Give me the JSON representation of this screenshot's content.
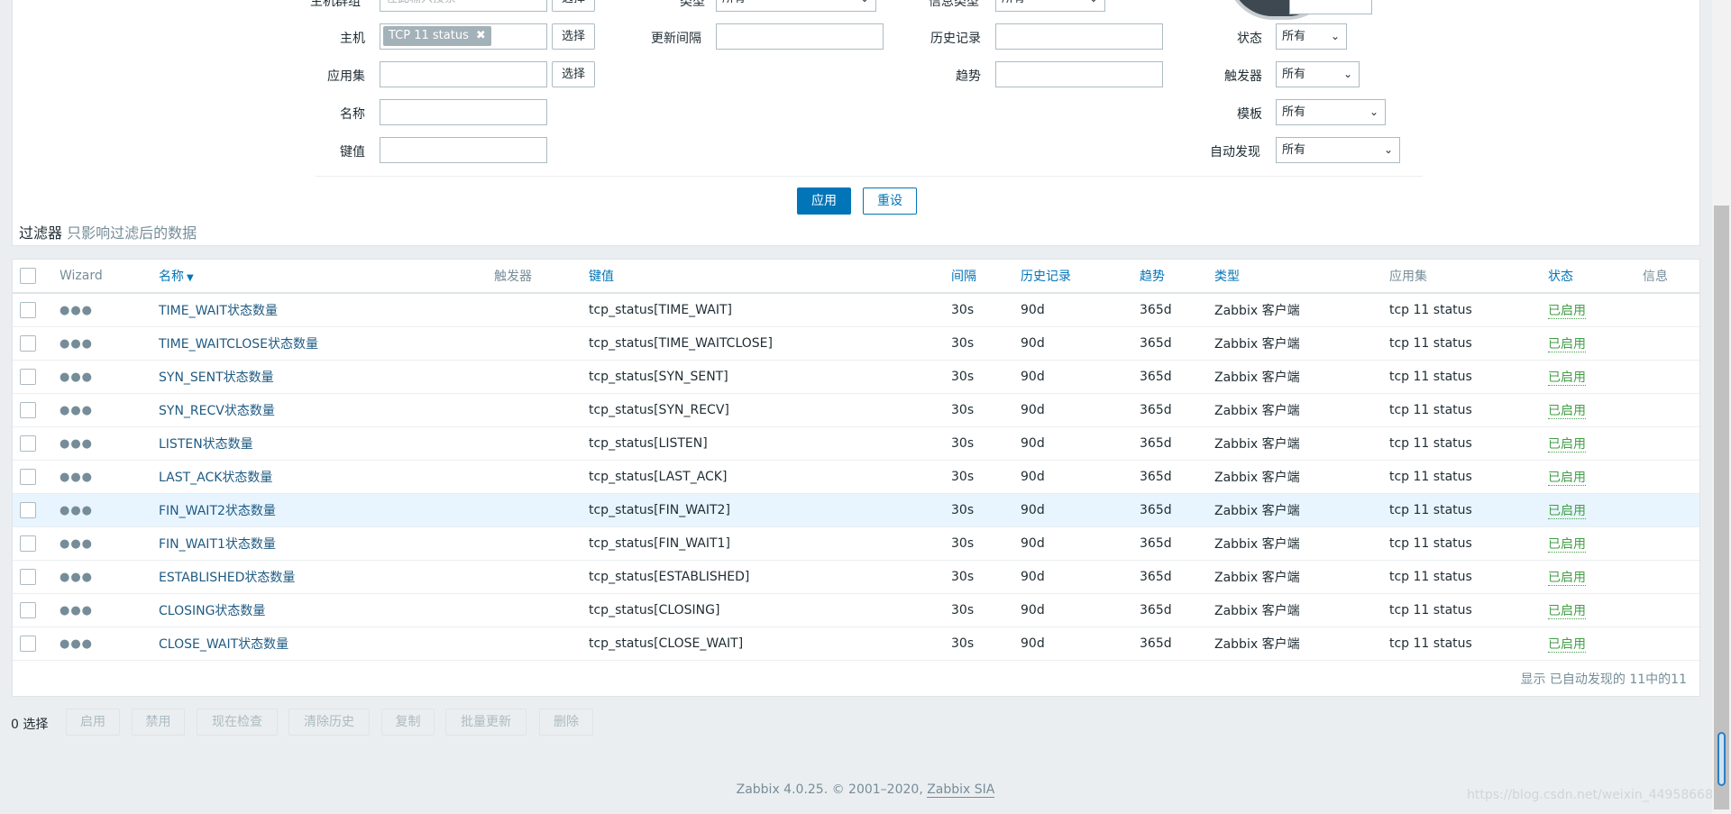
{
  "filter": {
    "top_partial": {
      "host_group_label": "主机群组",
      "host_group_placeholder": "在此输入搜索",
      "host_group_button": "选择",
      "type_label": "类型",
      "type_value": "所有",
      "info_type_label": "信息类型",
      "info_type_value": "所有"
    },
    "host_label": "主机",
    "host_tag": "TCP 11 status",
    "host_button": "选择",
    "application_label": "应用集",
    "application_button": "选择",
    "name_label": "名称",
    "key_label": "键值",
    "update_interval_label": "更新间隔",
    "history_label": "历史记录",
    "trends_label": "趋势",
    "state_label": "状态",
    "state_value": "所有",
    "triggers_label": "触发器",
    "triggers_value": "所有",
    "template_label": "模板",
    "template_value": "所有",
    "discovery_label": "自动发现",
    "discovery_value": "所有",
    "apply_button": "应用",
    "reset_button": "重设",
    "caption": "过滤器",
    "caption_sub": "只影响过滤后的数据"
  },
  "table": {
    "headers": {
      "wizard": "Wizard",
      "name": "名称",
      "triggers": "触发器",
      "key": "键值",
      "interval": "间隔",
      "history": "历史记录",
      "trends": "趋势",
      "type": "类型",
      "applications": "应用集",
      "status": "状态",
      "info": "信息"
    },
    "rows": [
      {
        "name": "TIME_WAIT状态数量",
        "key": "tcp_status[TIME_WAIT]",
        "interval": "30s",
        "history": "90d",
        "trends": "365d",
        "type": "Zabbix 客户端",
        "app": "tcp 11 status",
        "status": "已启用"
      },
      {
        "name": "TIME_WAITCLOSE状态数量",
        "key": "tcp_status[TIME_WAITCLOSE]",
        "interval": "30s",
        "history": "90d",
        "trends": "365d",
        "type": "Zabbix 客户端",
        "app": "tcp 11 status",
        "status": "已启用"
      },
      {
        "name": "SYN_SENT状态数量",
        "key": "tcp_status[SYN_SENT]",
        "interval": "30s",
        "history": "90d",
        "trends": "365d",
        "type": "Zabbix 客户端",
        "app": "tcp 11 status",
        "status": "已启用"
      },
      {
        "name": "SYN_RECV状态数量",
        "key": "tcp_status[SYN_RECV]",
        "interval": "30s",
        "history": "90d",
        "trends": "365d",
        "type": "Zabbix 客户端",
        "app": "tcp 11 status",
        "status": "已启用"
      },
      {
        "name": "LISTEN状态数量",
        "key": "tcp_status[LISTEN]",
        "interval": "30s",
        "history": "90d",
        "trends": "365d",
        "type": "Zabbix 客户端",
        "app": "tcp 11 status",
        "status": "已启用"
      },
      {
        "name": "LAST_ACK状态数量",
        "key": "tcp_status[LAST_ACK]",
        "interval": "30s",
        "history": "90d",
        "trends": "365d",
        "type": "Zabbix 客户端",
        "app": "tcp 11 status",
        "status": "已启用"
      },
      {
        "name": "FIN_WAIT2状态数量",
        "key": "tcp_status[FIN_WAIT2]",
        "interval": "30s",
        "history": "90d",
        "trends": "365d",
        "type": "Zabbix 客户端",
        "app": "tcp 11 status",
        "status": "已启用"
      },
      {
        "name": "FIN_WAIT1状态数量",
        "key": "tcp_status[FIN_WAIT1]",
        "interval": "30s",
        "history": "90d",
        "trends": "365d",
        "type": "Zabbix 客户端",
        "app": "tcp 11 status",
        "status": "已启用"
      },
      {
        "name": "ESTABLISHED状态数量",
        "key": "tcp_status[ESTABLISHED]",
        "interval": "30s",
        "history": "90d",
        "trends": "365d",
        "type": "Zabbix 客户端",
        "app": "tcp 11 status",
        "status": "已启用"
      },
      {
        "name": "CLOSING状态数量",
        "key": "tcp_status[CLOSING]",
        "interval": "30s",
        "history": "90d",
        "trends": "365d",
        "type": "Zabbix 客户端",
        "app": "tcp 11 status",
        "status": "已启用"
      },
      {
        "name": "CLOSE_WAIT状态数量",
        "key": "tcp_status[CLOSE_WAIT]",
        "interval": "30s",
        "history": "90d",
        "trends": "365d",
        "type": "Zabbix 客户端",
        "app": "tcp 11 status",
        "status": "已启用"
      }
    ],
    "summary": "显示 已自动发现的 11中的11"
  },
  "actions": {
    "selected_count": "0 选择",
    "buttons": [
      "启用",
      "禁用",
      "现在检查",
      "清除历史",
      "复制",
      "批量更新",
      "删除"
    ]
  },
  "footer": {
    "text": "Zabbix 4.0.25. © 2001–2020,",
    "link": "Zabbix SIA"
  },
  "watermark": "https://blog.csdn.net/weixin_44958668",
  "colors": {
    "link": "#0275b8",
    "status_enabled": "#429e47",
    "row_highlight": "#e8f5ff",
    "background": "#ebeef0"
  }
}
